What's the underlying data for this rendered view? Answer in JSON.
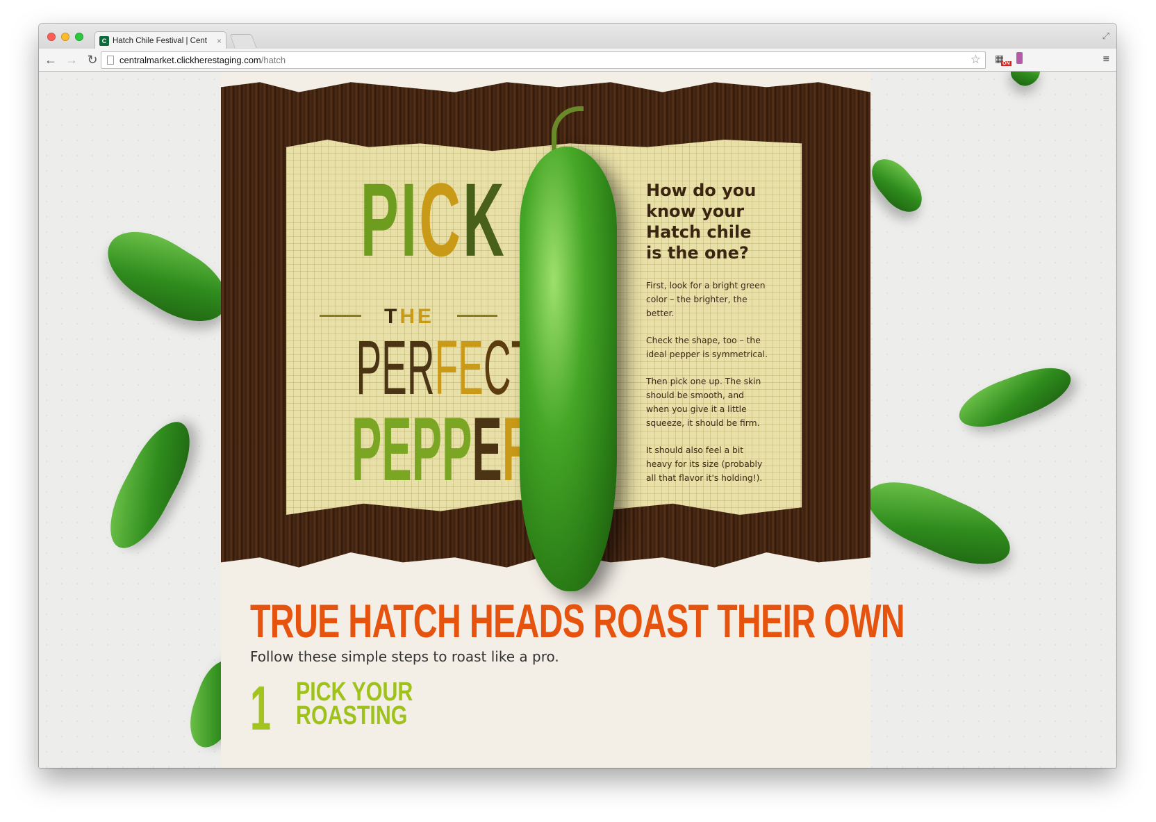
{
  "browser": {
    "tab_title": "Hatch Chile Festival | Cent",
    "tab_favicon_letter": "C",
    "tab_close": "×",
    "url_host": "centralmarket.clickherestaging.com",
    "url_path": "/hatch",
    "ext_badge": "ON",
    "back_icon": "←",
    "forward_icon": "→",
    "reload_icon": "↻",
    "star_icon": "☆",
    "menu_icon": "≡",
    "fullscreen_icon": "⤢"
  },
  "hero": {
    "headline_pick": [
      "PI",
      "C",
      "K"
    ],
    "headline_the": [
      "T",
      "H",
      "E"
    ],
    "headline_perfect": [
      "PER",
      "F",
      "E",
      "CT"
    ],
    "headline_pepper": [
      "PEPP",
      "E",
      "R"
    ],
    "question": "How do you know your Hatch chile is the one?",
    "paragraphs": [
      "First, look for a bright green color – the brighter, the better.",
      "Check the shape, too – the ideal pepper is symmetrical.",
      "Then pick one up. The skin should be smooth, and when you give it a little squeeze, it should be firm.",
      "It should also feel a bit heavy for its size (probably all that flavor it's holding!)."
    ]
  },
  "roast": {
    "title": "TRUE HATCH HEADS ROAST THEIR OWN",
    "subtitle": "Follow these simple steps to roast like a pro.",
    "step_number": "1",
    "step_title_line1": "PICK YOUR",
    "step_title_line2": "ROASTING"
  },
  "colors": {
    "accent_orange": "#e6530f",
    "chile_green": "#2f8c1d",
    "lime": "#9ec11c",
    "wood": "#3a200f",
    "paper": "#e8dfa9"
  }
}
